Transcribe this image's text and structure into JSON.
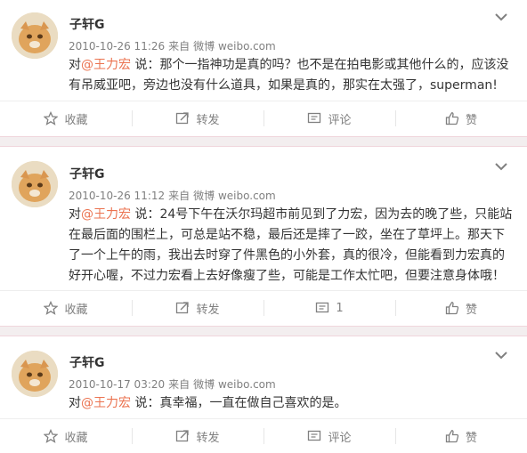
{
  "posts": [
    {
      "author": "子轩G",
      "timestamp": "2010-10-26 11:26",
      "source_prefix": "来自",
      "source": "微博 weibo.com",
      "prefix": "对",
      "mention": "@王力宏",
      "text": " 说：那个一指神功是真的吗？也不是在拍电影或其他什么的，应该没有吊威亚吧，旁边也没有什么道具，如果是真的，那实在太强了，superman!",
      "actions": {
        "favorite": "收藏",
        "repost": "转发",
        "comment": "评论",
        "like": "赞"
      }
    },
    {
      "author": "子轩G",
      "timestamp": "2010-10-26 11:12",
      "source_prefix": "来自",
      "source": "微博 weibo.com",
      "prefix": "对",
      "mention": "@王力宏",
      "text": " 说：24号下午在沃尔玛超市前见到了力宏，因为去的晚了些，只能站在最后面的围栏上，可总是站不稳，最后还是摔了一跤，坐在了草坪上。那天下了一个上午的雨，我出去时穿了件黑色的小外套，真的很冷，但能看到力宏真的好开心喔，不过力宏看上去好像瘦了些，可能是工作太忙吧，但要注意身体哦！",
      "actions": {
        "favorite": "收藏",
        "repost": "转发",
        "comment": "1",
        "like": "赞"
      }
    },
    {
      "author": "子轩G",
      "timestamp": "2010-10-17 03:20",
      "source_prefix": "来自",
      "source": "微博 weibo.com",
      "prefix": "对",
      "mention": "@王力宏",
      "text": " 说：真幸福，一直在做自己喜欢的是。",
      "actions": {
        "favorite": "收藏",
        "repost": "转发",
        "comment": "评论",
        "like": "赞"
      }
    }
  ],
  "icons": {
    "favorite": "star-icon",
    "repost": "repost-icon",
    "comment": "comment-icon",
    "like": "thumbs-up-icon",
    "menu": "chevron-down-icon"
  },
  "colors": {
    "mention": "#eb7350",
    "meta": "#808080",
    "separator": "#f3eeef"
  }
}
